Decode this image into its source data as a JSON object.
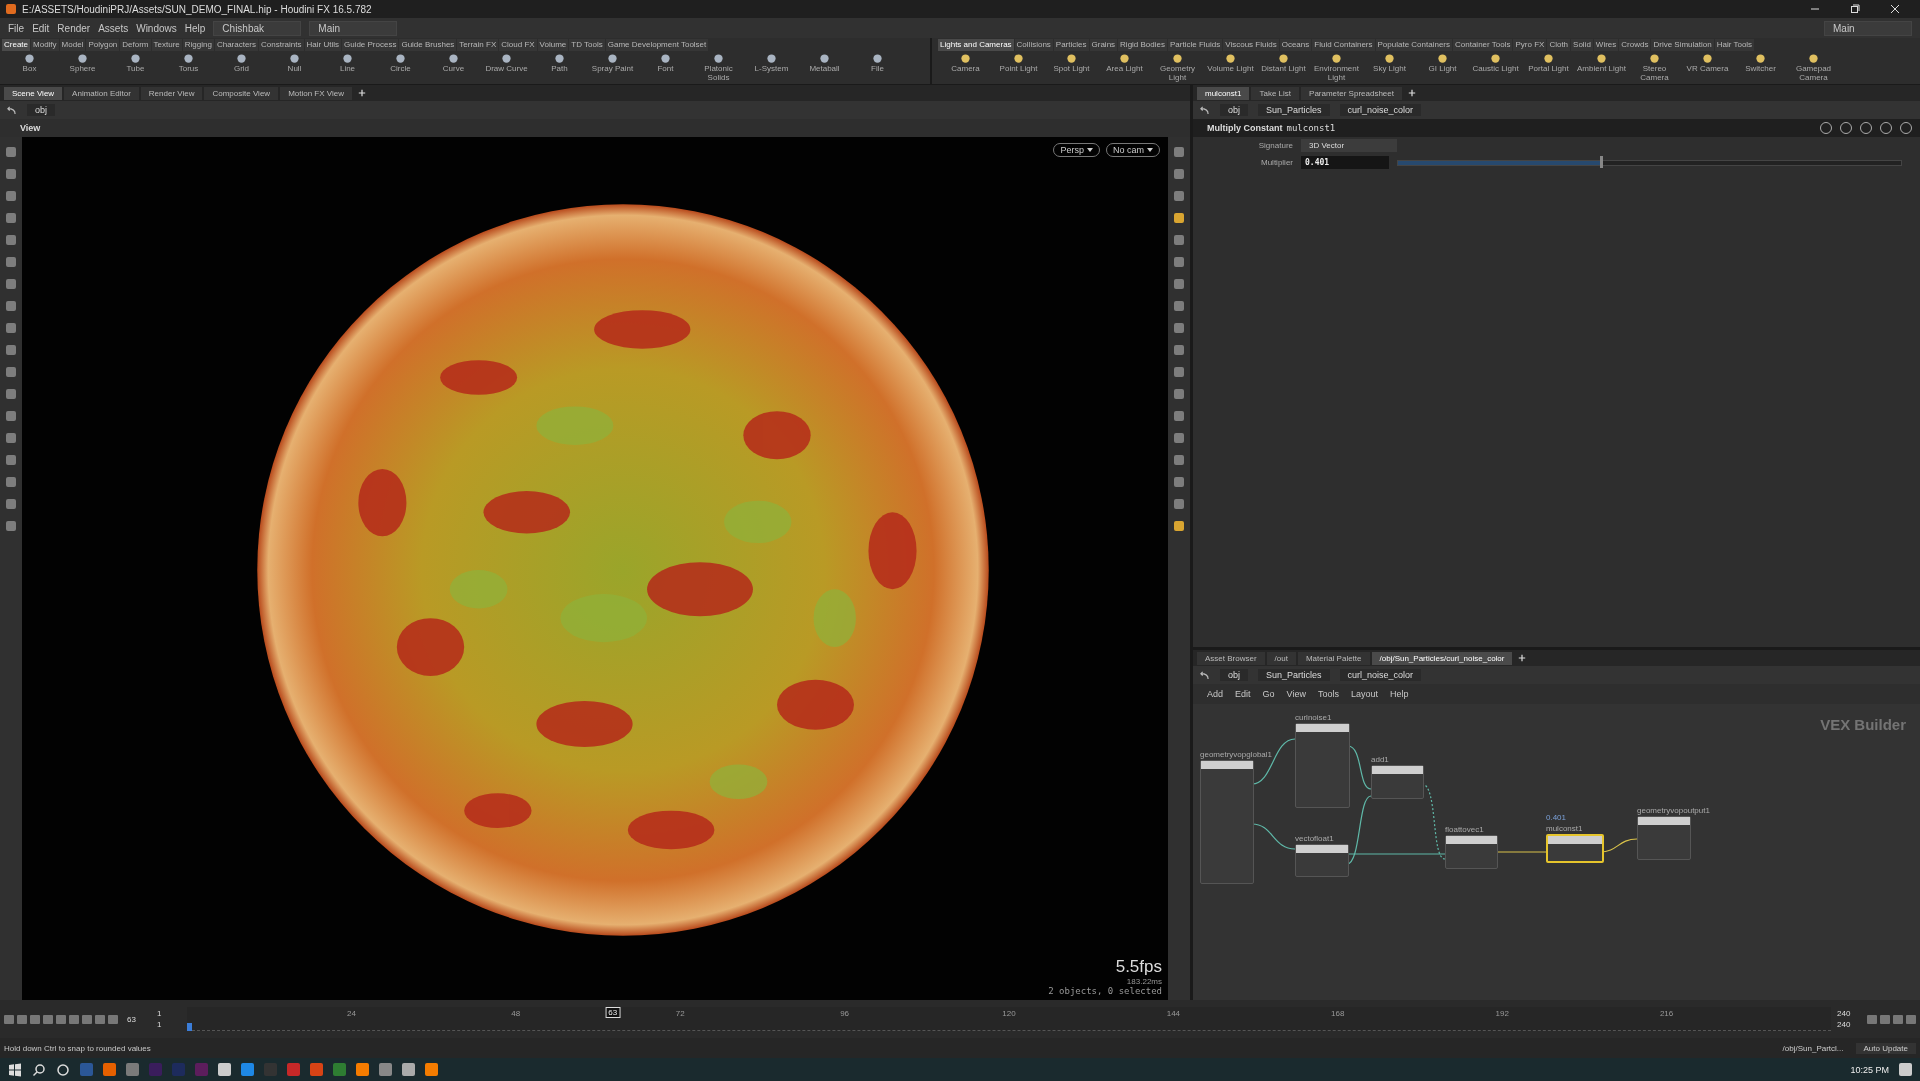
{
  "window": {
    "title": "E:/ASSETS/HoudiniPRJ/Assets/SUN_DEMO_FINAL.hip - Houdini FX 16.5.782"
  },
  "menu": [
    "File",
    "Edit",
    "Render",
    "Assets",
    "Windows",
    "Help"
  ],
  "desktop": {
    "left": "Chishbak",
    "main": "Main",
    "right": "Main"
  },
  "shelf_left": {
    "tabs": [
      {
        "label": "Create",
        "selected": true
      },
      {
        "label": "Modify",
        "selected": false
      },
      {
        "label": "Model",
        "selected": false
      },
      {
        "label": "Polygon",
        "selected": false
      },
      {
        "label": "Deform",
        "selected": false
      },
      {
        "label": "Texture",
        "selected": false
      },
      {
        "label": "Rigging",
        "selected": false
      },
      {
        "label": "Characters",
        "selected": false
      },
      {
        "label": "Constraints",
        "selected": false
      },
      {
        "label": "Hair Utils",
        "selected": false
      },
      {
        "label": "Guide Process",
        "selected": false
      },
      {
        "label": "Guide Brushes",
        "selected": false
      },
      {
        "label": "Terrain FX",
        "selected": false
      },
      {
        "label": "Cloud FX",
        "selected": false
      },
      {
        "label": "Volume",
        "selected": false
      },
      {
        "label": "TD Tools",
        "selected": false
      },
      {
        "label": "Game Development Toolset",
        "selected": false
      }
    ],
    "tools": [
      "Box",
      "Sphere",
      "Tube",
      "Torus",
      "Grid",
      "Null",
      "Line",
      "Circle",
      "Curve",
      "Draw Curve",
      "Path",
      "Spray Paint",
      "Font",
      "Platonic Solids",
      "L-System",
      "Metaball",
      "File"
    ]
  },
  "shelf_right": {
    "tabs": [
      {
        "label": "Lights and Cameras",
        "selected": true
      },
      {
        "label": "Collisions",
        "selected": false
      },
      {
        "label": "Particles",
        "selected": false
      },
      {
        "label": "Grains",
        "selected": false
      },
      {
        "label": "Rigid Bodies",
        "selected": false
      },
      {
        "label": "Particle Fluids",
        "selected": false
      },
      {
        "label": "Viscous Fluids",
        "selected": false
      },
      {
        "label": "Oceans",
        "selected": false
      },
      {
        "label": "Fluid Containers",
        "selected": false
      },
      {
        "label": "Populate Containers",
        "selected": false
      },
      {
        "label": "Container Tools",
        "selected": false
      },
      {
        "label": "Pyro FX",
        "selected": false
      },
      {
        "label": "Cloth",
        "selected": false
      },
      {
        "label": "Solid",
        "selected": false
      },
      {
        "label": "Wires",
        "selected": false
      },
      {
        "label": "Crowds",
        "selected": false
      },
      {
        "label": "Drive Simulation",
        "selected": false
      },
      {
        "label": "Hair Tools",
        "selected": false
      }
    ],
    "tools": [
      "Camera",
      "Point Light",
      "Spot Light",
      "Area Light",
      "Geometry Light",
      "Volume Light",
      "Distant Light",
      "Environment Light",
      "Sky Light",
      "GI Light",
      "Caustic Light",
      "Portal Light",
      "Ambient Light",
      "Stereo Camera",
      "VR Camera",
      "Switcher",
      "Gamepad Camera"
    ]
  },
  "scene_pane": {
    "tabs": [
      {
        "label": "Scene View",
        "selected": true
      },
      {
        "label": "Animation Editor",
        "selected": false
      },
      {
        "label": "Render View",
        "selected": false
      },
      {
        "label": "Composite View",
        "selected": false
      },
      {
        "label": "Motion FX View",
        "selected": false
      }
    ],
    "path": "obj",
    "view_label": "View"
  },
  "viewport": {
    "perspective": "Persp",
    "camera": "No cam",
    "fps": "5.5fps",
    "frame_time": "183.22ms",
    "selection_info": "2 objects, 0 selected"
  },
  "param_pane": {
    "tabs": [
      {
        "label": "mulconst1",
        "selected": true
      },
      {
        "label": "Take List",
        "selected": false
      },
      {
        "label": "Parameter Spreadsheet",
        "selected": false
      }
    ],
    "path": [
      "obj",
      "Sun_Particles",
      "curl_noise_color"
    ],
    "node_type": "Multiply Constant",
    "node_name": "mulconst1",
    "params": [
      {
        "label": "Signature",
        "kind": "menu",
        "value": "3D Vector"
      },
      {
        "label": "Multiplier",
        "kind": "slider",
        "value": "0.401",
        "level": 0.401
      }
    ]
  },
  "network_pane": {
    "tabs": [
      {
        "label": "Asset Browser",
        "selected": false
      },
      {
        "label": "/out",
        "selected": false
      },
      {
        "label": "Material Palette",
        "selected": false
      },
      {
        "label": "/obj/Sun_Particles/curl_noise_color",
        "selected": true
      }
    ],
    "path": [
      "obj",
      "Sun_Particles",
      "curl_noise_color"
    ],
    "menu": [
      "Add",
      "Edit",
      "Go",
      "View",
      "Tools",
      "Layout",
      "Help"
    ],
    "context": "VEX Builder",
    "nodes": [
      {
        "name": "geometryvopglobal1",
        "selected": false
      },
      {
        "name": "curlnoise1",
        "selected": false
      },
      {
        "name": "add1",
        "selected": false
      },
      {
        "name": "vectofloat1",
        "selected": false
      },
      {
        "name": "floattovec1",
        "selected": false
      },
      {
        "name": "mulconst1",
        "value": "0.401",
        "selected": true
      },
      {
        "name": "geometryvopoutput1",
        "selected": false
      }
    ]
  },
  "timeline": {
    "start": "1",
    "range_start": "1",
    "ticks": [
      "24",
      "48",
      "72",
      "96",
      "120",
      "144",
      "168",
      "192",
      "216"
    ],
    "current_frame": "63",
    "frame_field": "63",
    "level": 0.259,
    "end": "240",
    "range_end": "240"
  },
  "status_bar": {
    "message": "Hold down Ctrl to snap to rounded values",
    "path": "/obj/Sun_Partcl...",
    "update_mode": "Auto Update"
  },
  "taskbar": {
    "time": "10:25 PM"
  }
}
